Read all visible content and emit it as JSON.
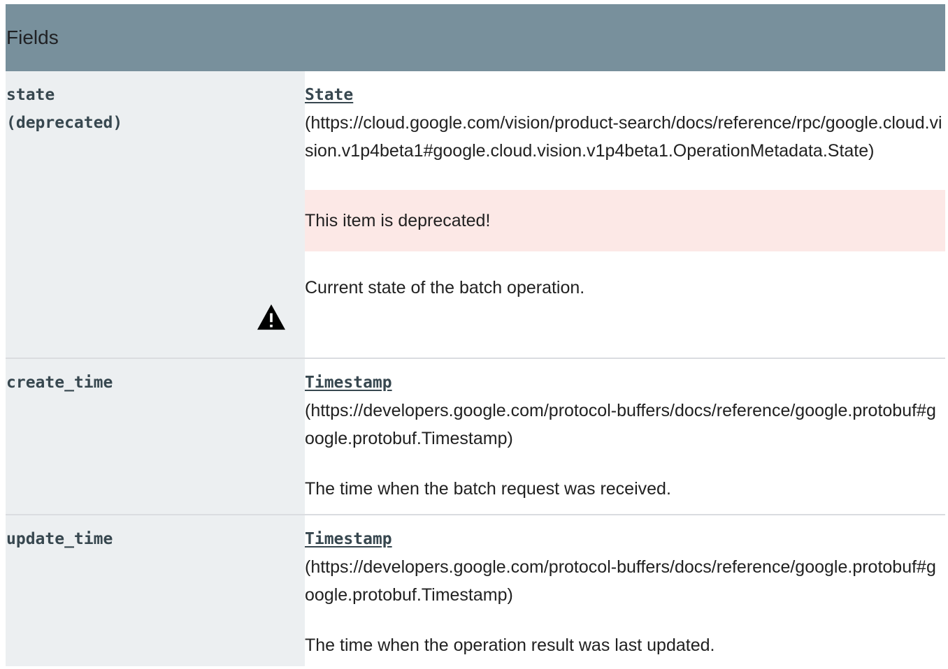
{
  "table": {
    "header": "Fields",
    "rows": [
      {
        "name_line1": "state",
        "name_line2": "(deprecated)",
        "type": "State",
        "type_url": " (https://cloud.google.com/vision/product-search/docs/reference/rpc/google.cloud.vision.v1p4beta1#google.cloud.vision.v1p4beta1.OperationMetadata.State)",
        "warning": "This item is deprecated!",
        "description": "Current state of the batch operation."
      },
      {
        "name": "create_time",
        "type": "Timestamp",
        "type_url": " (https://developers.google.com/protocol-buffers/docs/reference/google.protobuf#google.protobuf.Timestamp)",
        "description": "The time when the batch request was received."
      },
      {
        "name": "update_time",
        "type": "Timestamp",
        "type_url": " (https://developers.google.com/protocol-buffers/docs/reference/google.protobuf#google.protobuf.Timestamp)",
        "description": "The time when the operation result was last updated."
      }
    ]
  },
  "icons": {
    "warning": "warning-icon"
  },
  "colors": {
    "header_bg": "#78909c",
    "name_col_bg": "#eceff1",
    "warning_bg": "#fce8e6"
  }
}
